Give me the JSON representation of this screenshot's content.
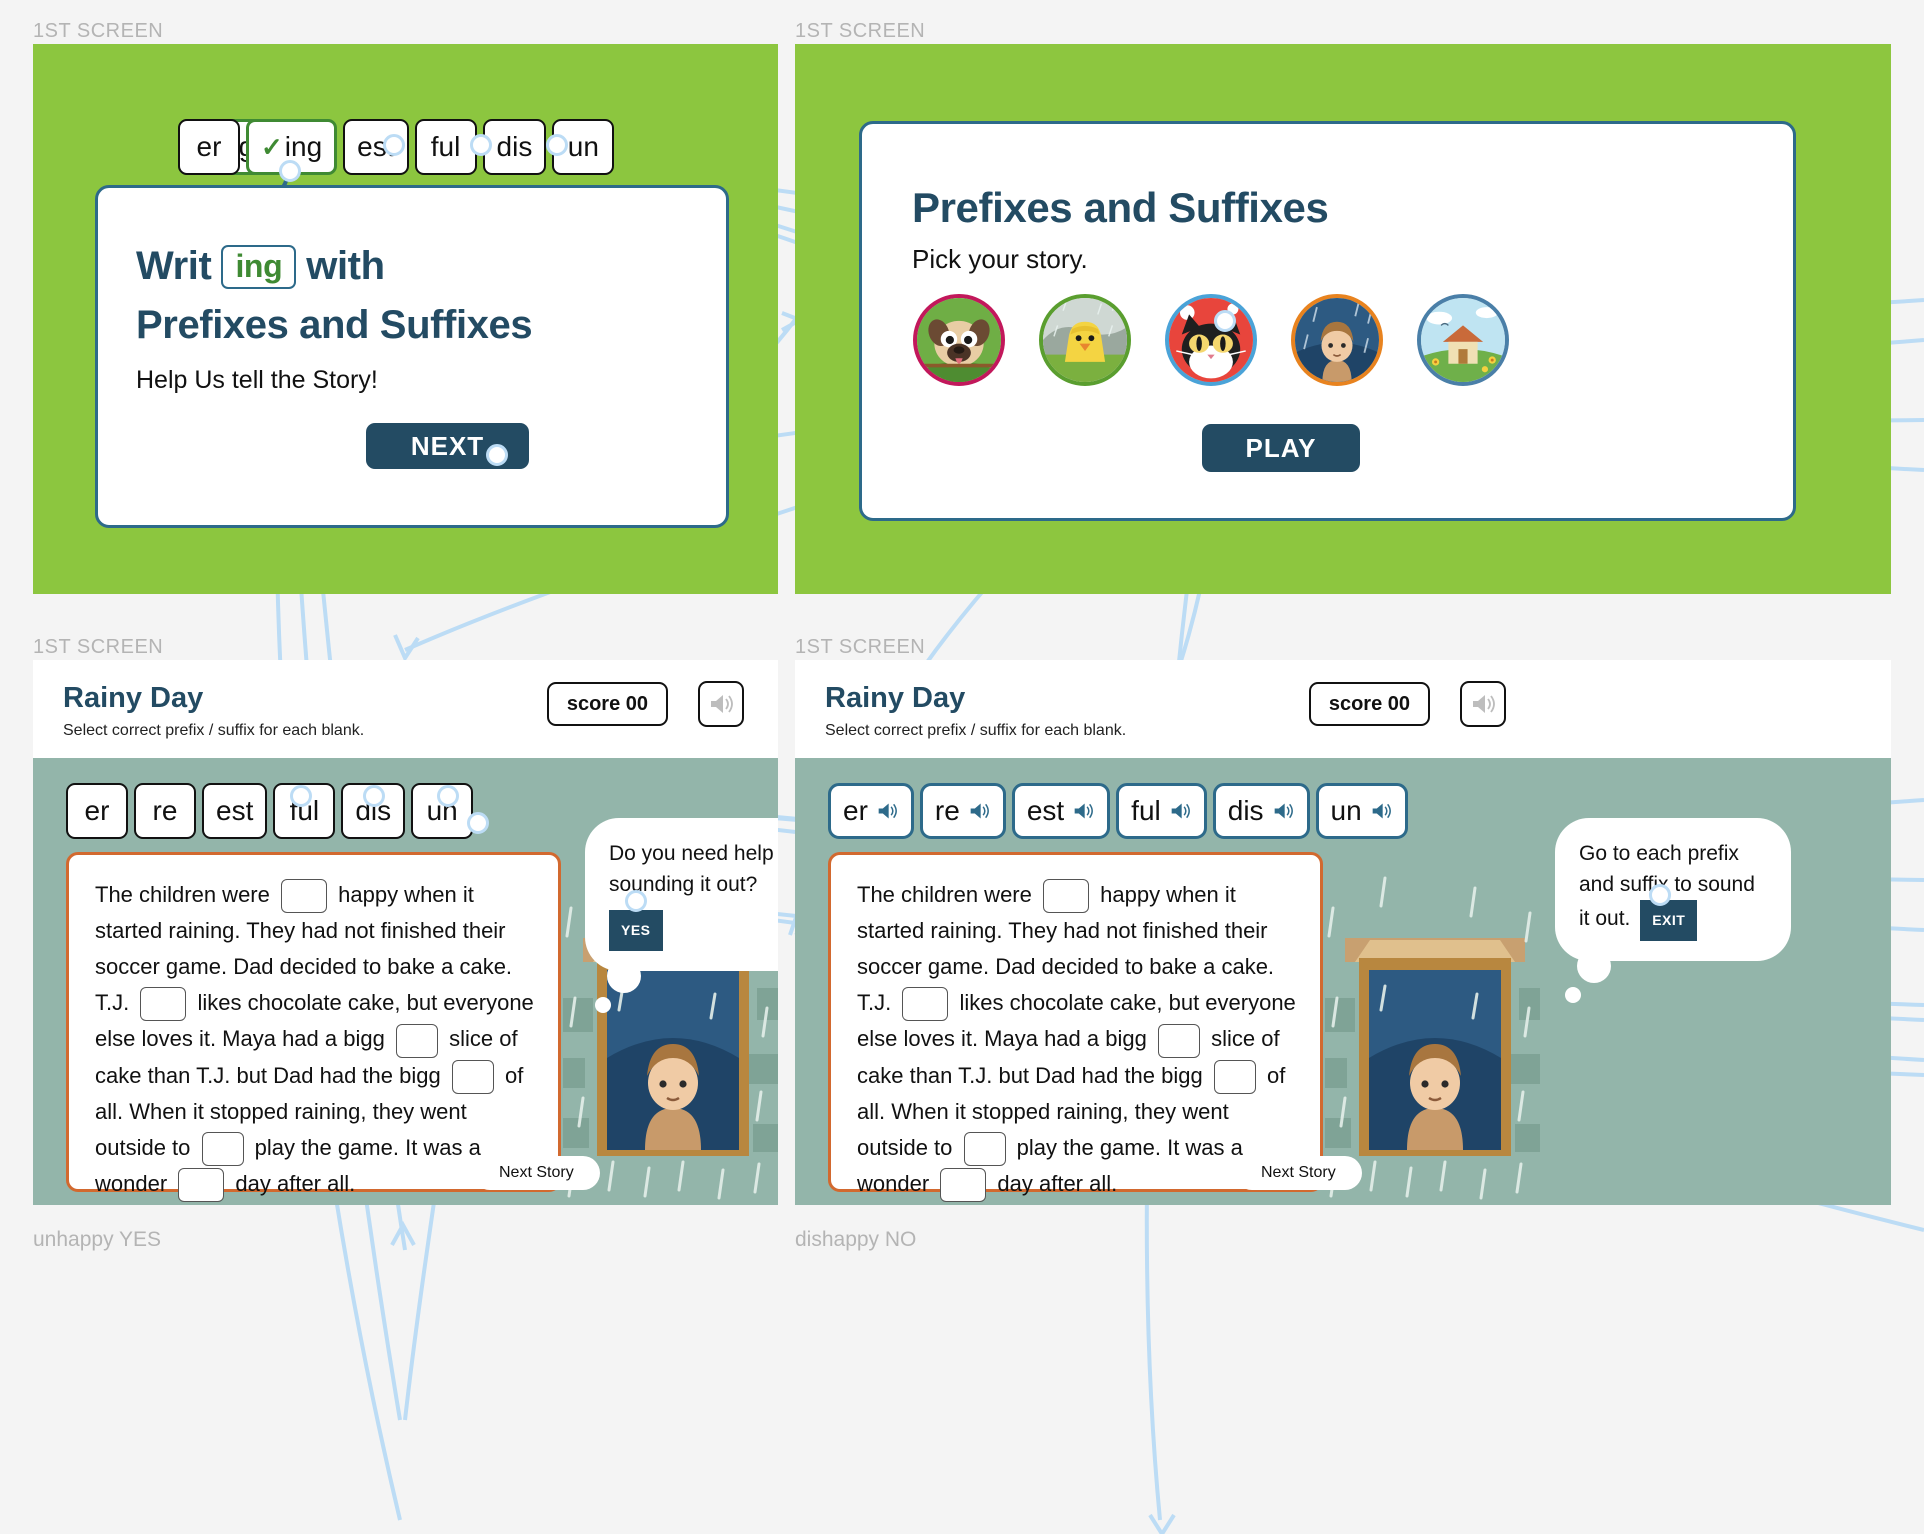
{
  "labels": {
    "screen_tl": "1ST SCREEN",
    "screen_tr": "1ST SCREEN",
    "screen_bl": "1ST SCREEN",
    "screen_br": "1ST SCREEN",
    "bottom_left_note": "unhappy YES",
    "bottom_right_note": "dishappy NO"
  },
  "colors": {
    "green_bg": "#8cc63f",
    "navy": "#234b63",
    "card_border": "#2d6a8a",
    "story_bg": "#93b5aa",
    "text_card_border": "#d2692f",
    "check_green": "#3f8a33",
    "link_blue": "#bcdcf5"
  },
  "intro": {
    "chips": [
      {
        "label": "er",
        "selected": false
      },
      {
        "label": "ing",
        "selected": true
      },
      {
        "label": "est",
        "selected": false
      },
      {
        "label": "ful",
        "selected": false
      },
      {
        "label": "dis",
        "selected": false
      },
      {
        "label": "un",
        "selected": false
      }
    ],
    "title_pre": "Writ",
    "title_box": "ing",
    "title_post": "with",
    "title_line2": "Prefixes and Suffixes",
    "subtitle": "Help Us tell the Story!",
    "next_button": "NEXT"
  },
  "picker": {
    "title": "Prefixes and Suffixes",
    "subtitle": "Pick your story.",
    "play_button": "PLAY",
    "stories": [
      {
        "name": "pug-story-avatar",
        "ring": "#c2185b"
      },
      {
        "name": "duck-raincoat-story-avatar",
        "ring": "#5a9e2f"
      },
      {
        "name": "cat-story-avatar",
        "ring": "#4aa3d8"
      },
      {
        "name": "rainy-day-story-avatar",
        "ring": "#e8831f"
      },
      {
        "name": "house-story-avatar",
        "ring": "#4a7fa8"
      }
    ]
  },
  "story_left": {
    "title": "Rainy Day",
    "instruction": "Select correct prefix / suffix for each blank.",
    "score_label": "score 00",
    "speaker_icon": "speaker-icon",
    "chips": [
      "er",
      "re",
      "est",
      "ful",
      "dis",
      "un"
    ],
    "text_parts": [
      "The children were",
      "happy when it started raining. They had not finished their soccer game.",
      "Dad decided to bake a cake. T.J.",
      "likes chocolate cake, but everyone else loves it. Maya had a bigg",
      "slice of cake than T.J. but Dad had the bigg",
      "of all. When it stopped raining, they went outside to",
      "play the game. It was a wonder",
      "day after all."
    ],
    "bubble_text": "Do you need help sounding it out?",
    "bubble_button": "YES",
    "next_story_button": "Next Story"
  },
  "story_right": {
    "title": "Rainy Day",
    "instruction": "Select correct prefix / suffix for each blank.",
    "score_label": "score 00",
    "speaker_icon": "speaker-icon",
    "chips": [
      "er",
      "re",
      "est",
      "ful",
      "dis",
      "un"
    ],
    "text_parts": [
      "The children were",
      "happy when it started raining. They had not finished their soccer game.",
      "Dad decided to bake a cake. T.J.",
      "likes chocolate cake, but everyone else loves it. Maya had a bigg",
      "slice of cake than T.J. but Dad had the bigg",
      "of all. When it stopped raining, they went outside to",
      "play the game. It was a wonder",
      "day after all."
    ],
    "bubble_text": "Go to each prefix and suffix to sound it out.",
    "bubble_button": "EXIT",
    "next_story_button": "Next Story"
  }
}
